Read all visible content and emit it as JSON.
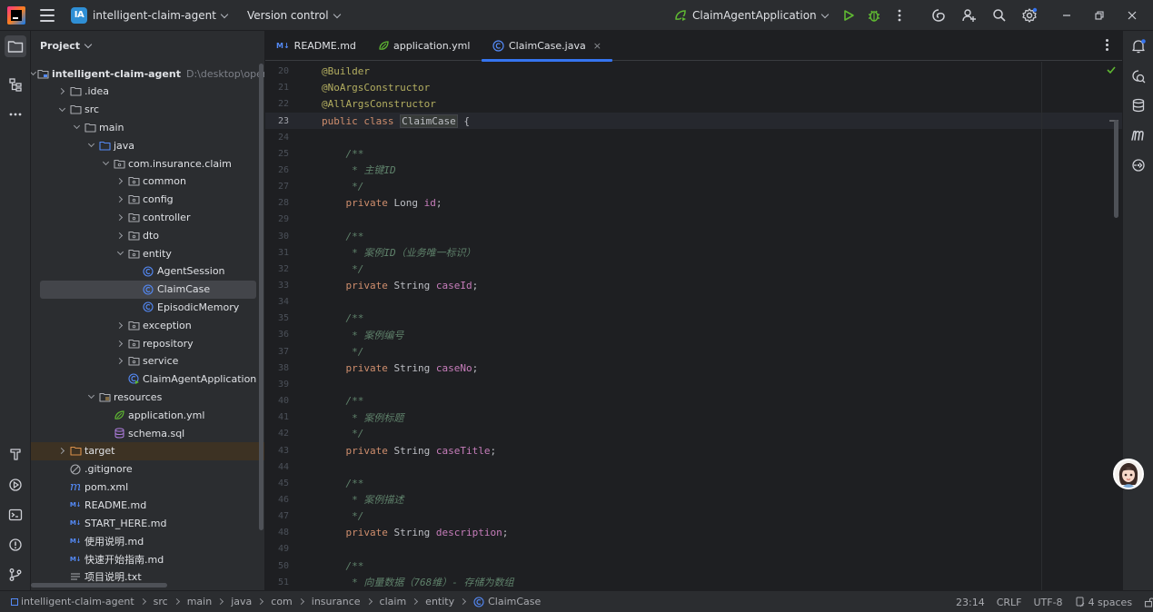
{
  "titlebar": {
    "project_badge": "IA",
    "project_name": "intelligent-claim-agent",
    "version_control": "Version control",
    "run_config": "ClaimAgentApplication"
  },
  "project_panel": {
    "title": "Project",
    "root_path": "D:\\desktop\\openga",
    "tree": [
      {
        "label": "intelligent-claim-agent",
        "depth": 0,
        "toggle": "open",
        "icon": "module-folder-icon",
        "bold": true
      },
      {
        "label": ".idea",
        "depth": 1,
        "toggle": "closed",
        "icon": "folder-icon"
      },
      {
        "label": "src",
        "depth": 1,
        "toggle": "open",
        "icon": "folder-icon"
      },
      {
        "label": "main",
        "depth": 2,
        "toggle": "open",
        "icon": "folder-icon"
      },
      {
        "label": "java",
        "depth": 3,
        "toggle": "open",
        "icon": "source-folder-icon"
      },
      {
        "label": "com.insurance.claim",
        "depth": 4,
        "toggle": "open",
        "icon": "package-icon"
      },
      {
        "label": "common",
        "depth": 5,
        "toggle": "closed",
        "icon": "package-icon"
      },
      {
        "label": "config",
        "depth": 5,
        "toggle": "closed",
        "icon": "package-icon"
      },
      {
        "label": "controller",
        "depth": 5,
        "toggle": "closed",
        "icon": "package-icon"
      },
      {
        "label": "dto",
        "depth": 5,
        "toggle": "closed",
        "icon": "package-icon"
      },
      {
        "label": "entity",
        "depth": 5,
        "toggle": "open",
        "icon": "package-icon"
      },
      {
        "label": "AgentSession",
        "depth": 6,
        "toggle": "none",
        "icon": "class-icon"
      },
      {
        "label": "ClaimCase",
        "depth": 6,
        "toggle": "none",
        "icon": "class-icon",
        "selected": true
      },
      {
        "label": "EpisodicMemory",
        "depth": 6,
        "toggle": "none",
        "icon": "class-icon"
      },
      {
        "label": "exception",
        "depth": 5,
        "toggle": "closed",
        "icon": "package-icon"
      },
      {
        "label": "repository",
        "depth": 5,
        "toggle": "closed",
        "icon": "package-icon"
      },
      {
        "label": "service",
        "depth": 5,
        "toggle": "closed",
        "icon": "package-icon"
      },
      {
        "label": "ClaimAgentApplication",
        "depth": 5,
        "toggle": "none",
        "icon": "spring-class-icon"
      },
      {
        "label": "resources",
        "depth": 3,
        "toggle": "open",
        "icon": "resources-folder-icon"
      },
      {
        "label": "application.yml",
        "depth": 4,
        "toggle": "none",
        "icon": "yaml-icon"
      },
      {
        "label": "schema.sql",
        "depth": 4,
        "toggle": "none",
        "icon": "sql-icon"
      },
      {
        "label": "target",
        "depth": 1,
        "toggle": "closed",
        "icon": "excluded-folder-icon",
        "highlight": true
      },
      {
        "label": ".gitignore",
        "depth": 1,
        "toggle": "none",
        "icon": "ignore-icon"
      },
      {
        "label": "pom.xml",
        "depth": 1,
        "toggle": "none",
        "icon": "maven-icon"
      },
      {
        "label": "README.md",
        "depth": 1,
        "toggle": "none",
        "icon": "markdown-icon"
      },
      {
        "label": "START_HERE.md",
        "depth": 1,
        "toggle": "none",
        "icon": "markdown-icon"
      },
      {
        "label": "使用说明.md",
        "depth": 1,
        "toggle": "none",
        "icon": "markdown-icon"
      },
      {
        "label": "快速开始指南.md",
        "depth": 1,
        "toggle": "none",
        "icon": "markdown-icon"
      },
      {
        "label": "项目说明.txt",
        "depth": 1,
        "toggle": "none",
        "icon": "text-file-icon"
      }
    ]
  },
  "editor": {
    "tabs": [
      {
        "label": "README.md",
        "badge": "M↓",
        "icon": "markdown-icon"
      },
      {
        "label": "application.yml",
        "icon": "yaml-icon"
      },
      {
        "label": "ClaimCase.java",
        "icon": "class-icon",
        "active": true
      }
    ],
    "tab_close_symbol": "×",
    "lines": [
      {
        "n": "20",
        "parts": [
          [
            "ann",
            "@Builder"
          ]
        ]
      },
      {
        "n": "21",
        "parts": [
          [
            "ann",
            "@NoArgsConstructor"
          ]
        ]
      },
      {
        "n": "22",
        "parts": [
          [
            "ann",
            "@AllArgsConstructor"
          ]
        ]
      },
      {
        "n": "23",
        "current": true,
        "parts": [
          [
            "kw",
            "public class "
          ],
          [
            "clsh",
            "ClaimCase"
          ],
          [
            "txt",
            " {"
          ]
        ]
      },
      {
        "n": "24",
        "parts": []
      },
      {
        "n": "25",
        "parts": [
          [
            "cm",
            "    /**"
          ]
        ]
      },
      {
        "n": "26",
        "parts": [
          [
            "cm",
            "     * 主键ID"
          ]
        ]
      },
      {
        "n": "27",
        "parts": [
          [
            "cm",
            "     */"
          ]
        ]
      },
      {
        "n": "28",
        "parts": [
          [
            "kw",
            "    private "
          ],
          [
            "txt",
            "Long "
          ],
          [
            "fld",
            "id"
          ],
          [
            "txt",
            ";"
          ]
        ]
      },
      {
        "n": "29",
        "parts": []
      },
      {
        "n": "30",
        "parts": [
          [
            "cm",
            "    /**"
          ]
        ]
      },
      {
        "n": "31",
        "parts": [
          [
            "cm",
            "     * 案例ID（业务唯一标识）"
          ]
        ]
      },
      {
        "n": "32",
        "parts": [
          [
            "cm",
            "     */"
          ]
        ]
      },
      {
        "n": "33",
        "parts": [
          [
            "kw",
            "    private "
          ],
          [
            "txt",
            "String "
          ],
          [
            "fld",
            "caseId"
          ],
          [
            "txt",
            ";"
          ]
        ]
      },
      {
        "n": "34",
        "parts": []
      },
      {
        "n": "35",
        "parts": [
          [
            "cm",
            "    /**"
          ]
        ]
      },
      {
        "n": "36",
        "parts": [
          [
            "cm",
            "     * 案例编号"
          ]
        ]
      },
      {
        "n": "37",
        "parts": [
          [
            "cm",
            "     */"
          ]
        ]
      },
      {
        "n": "38",
        "parts": [
          [
            "kw",
            "    private "
          ],
          [
            "txt",
            "String "
          ],
          [
            "fld",
            "caseNo"
          ],
          [
            "txt",
            ";"
          ]
        ]
      },
      {
        "n": "39",
        "parts": []
      },
      {
        "n": "40",
        "parts": [
          [
            "cm",
            "    /**"
          ]
        ]
      },
      {
        "n": "41",
        "parts": [
          [
            "cm",
            "     * 案例标题"
          ]
        ]
      },
      {
        "n": "42",
        "parts": [
          [
            "cm",
            "     */"
          ]
        ]
      },
      {
        "n": "43",
        "parts": [
          [
            "kw",
            "    private "
          ],
          [
            "txt",
            "String "
          ],
          [
            "fld",
            "caseTitle"
          ],
          [
            "txt",
            ";"
          ]
        ]
      },
      {
        "n": "44",
        "parts": []
      },
      {
        "n": "45",
        "parts": [
          [
            "cm",
            "    /**"
          ]
        ]
      },
      {
        "n": "46",
        "parts": [
          [
            "cm",
            "     * 案例描述"
          ]
        ]
      },
      {
        "n": "47",
        "parts": [
          [
            "cm",
            "     */"
          ]
        ]
      },
      {
        "n": "48",
        "parts": [
          [
            "kw",
            "    private "
          ],
          [
            "txt",
            "String "
          ],
          [
            "fld",
            "description"
          ],
          [
            "txt",
            ";"
          ]
        ]
      },
      {
        "n": "49",
        "parts": []
      },
      {
        "n": "50",
        "parts": [
          [
            "cm",
            "    /**"
          ]
        ]
      },
      {
        "n": "51",
        "parts": [
          [
            "cm",
            "     * 向量数据（768维）- 存储为数组"
          ]
        ]
      }
    ]
  },
  "statusbar": {
    "breadcrumbs": [
      "intelligent-claim-agent",
      "src",
      "main",
      "java",
      "com",
      "insurance",
      "claim",
      "entity",
      "ClaimCase"
    ],
    "position": "23:14",
    "line_ending": "CRLF",
    "encoding": "UTF-8",
    "indent": "4 spaces"
  },
  "colors": {
    "accent": "#3574f0",
    "annotation": "#b3ae60",
    "keyword": "#cf8e6d",
    "comment": "#5f826b",
    "field": "#c77dbb"
  }
}
